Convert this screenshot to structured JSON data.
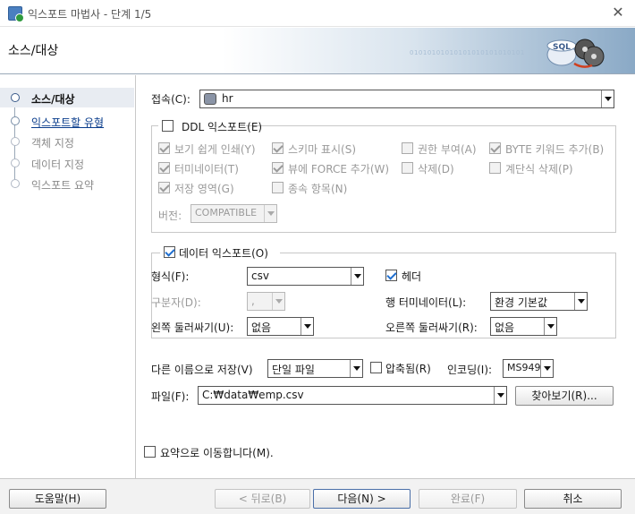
{
  "window": {
    "title": "익스포트 마법사 - 단계 1/5",
    "close": "✕"
  },
  "header": {
    "title": "소스/대상",
    "binary": "01010101010101010101010101",
    "logo_text": "SQL"
  },
  "steps": [
    {
      "label": "소스/대상",
      "state": "active"
    },
    {
      "label": "익스포트할 유형",
      "state": "link"
    },
    {
      "label": "객체 지정",
      "state": "disabled"
    },
    {
      "label": "데이터 지정",
      "state": "disabled"
    },
    {
      "label": "익스포트 요약",
      "state": "disabled"
    }
  ],
  "connection": {
    "label": "접속(C):",
    "value": "hr"
  },
  "ddl": {
    "title": "DDL 익스포트(E)",
    "checked": false,
    "options": [
      {
        "label": "보기 쉽게 인쇄(Y)",
        "checked": true
      },
      {
        "label": "스키마 표시(S)",
        "checked": true
      },
      {
        "label": "권한 부여(A)",
        "checked": false
      },
      {
        "label": "BYTE 키워드 추가(B)",
        "checked": true
      },
      {
        "label": "터미네이터(T)",
        "checked": true
      },
      {
        "label": "뷰에 FORCE 추가(W)",
        "checked": true
      },
      {
        "label": "삭제(D)",
        "checked": false
      },
      {
        "label": "계단식 삭제(P)",
        "checked": false
      },
      {
        "label": "저장 영역(G)",
        "checked": true
      },
      {
        "label": "종속 항목(N)",
        "checked": false
      }
    ],
    "version_label": "버전:",
    "version_value": "COMPATIBLE"
  },
  "data_export": {
    "title": "데이터 익스포트(O)",
    "checked": true,
    "format_label": "형식(F):",
    "format_value": "csv",
    "header_label": "헤더",
    "header_checked": true,
    "delimiter_label": "구분자(D):",
    "delimiter_value": ",",
    "row_terminator_label": "행 터미네이터(L):",
    "row_terminator_value": "환경 기본값",
    "left_enclosure_label": "왼쪽 둘러싸기(U):",
    "left_enclosure_value": "없음",
    "right_enclosure_label": "오른쪽 둘러싸기(R):",
    "right_enclosure_value": "없음"
  },
  "save": {
    "save_as_label": "다른 이름으로 저장(V)",
    "save_as_value": "단일 파일",
    "compressed_label": "압축됨(R)",
    "compressed_checked": false,
    "encoding_label": "인코딩(I):",
    "encoding_value": "MS949",
    "file_label": "파일(F):",
    "file_value": "C:₩data₩emp.csv",
    "browse_label": "찾아보기(R)..."
  },
  "summary_jump": {
    "label": "요약으로 이동합니다(M).",
    "checked": false
  },
  "footer": {
    "help": "도움말(H)",
    "back": "< 뒤로(B)",
    "next": "다음(N) >",
    "finish": "완료(F)",
    "cancel": "취소"
  }
}
